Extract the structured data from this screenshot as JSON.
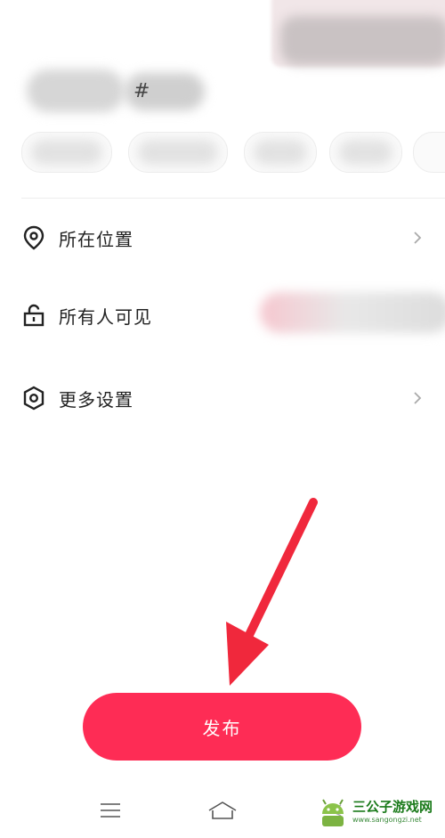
{
  "header": {
    "hashtag_glyph": "#",
    "tag_hash_glyph": "#",
    "tag_count": 5
  },
  "settings": {
    "items": [
      {
        "label": "所在位置",
        "icon": "location-pin-icon",
        "has_chevron": true
      },
      {
        "label": "所有人可见",
        "icon": "unlock-icon",
        "has_chevron": false
      },
      {
        "label": "更多设置",
        "icon": "hexagon-settings-icon",
        "has_chevron": true
      }
    ]
  },
  "publish": {
    "label": "发布",
    "color": "#fe2c55"
  },
  "annotation": {
    "arrow_color": "#f0283c",
    "icon": "red-arrow-icon"
  },
  "navbar": {
    "items": [
      "menu-icon",
      "home-icon",
      "back-icon"
    ]
  },
  "watermark": {
    "title": "三公子游戏网",
    "url": "www.sangongzi.net",
    "icon": "android-logo-icon"
  }
}
